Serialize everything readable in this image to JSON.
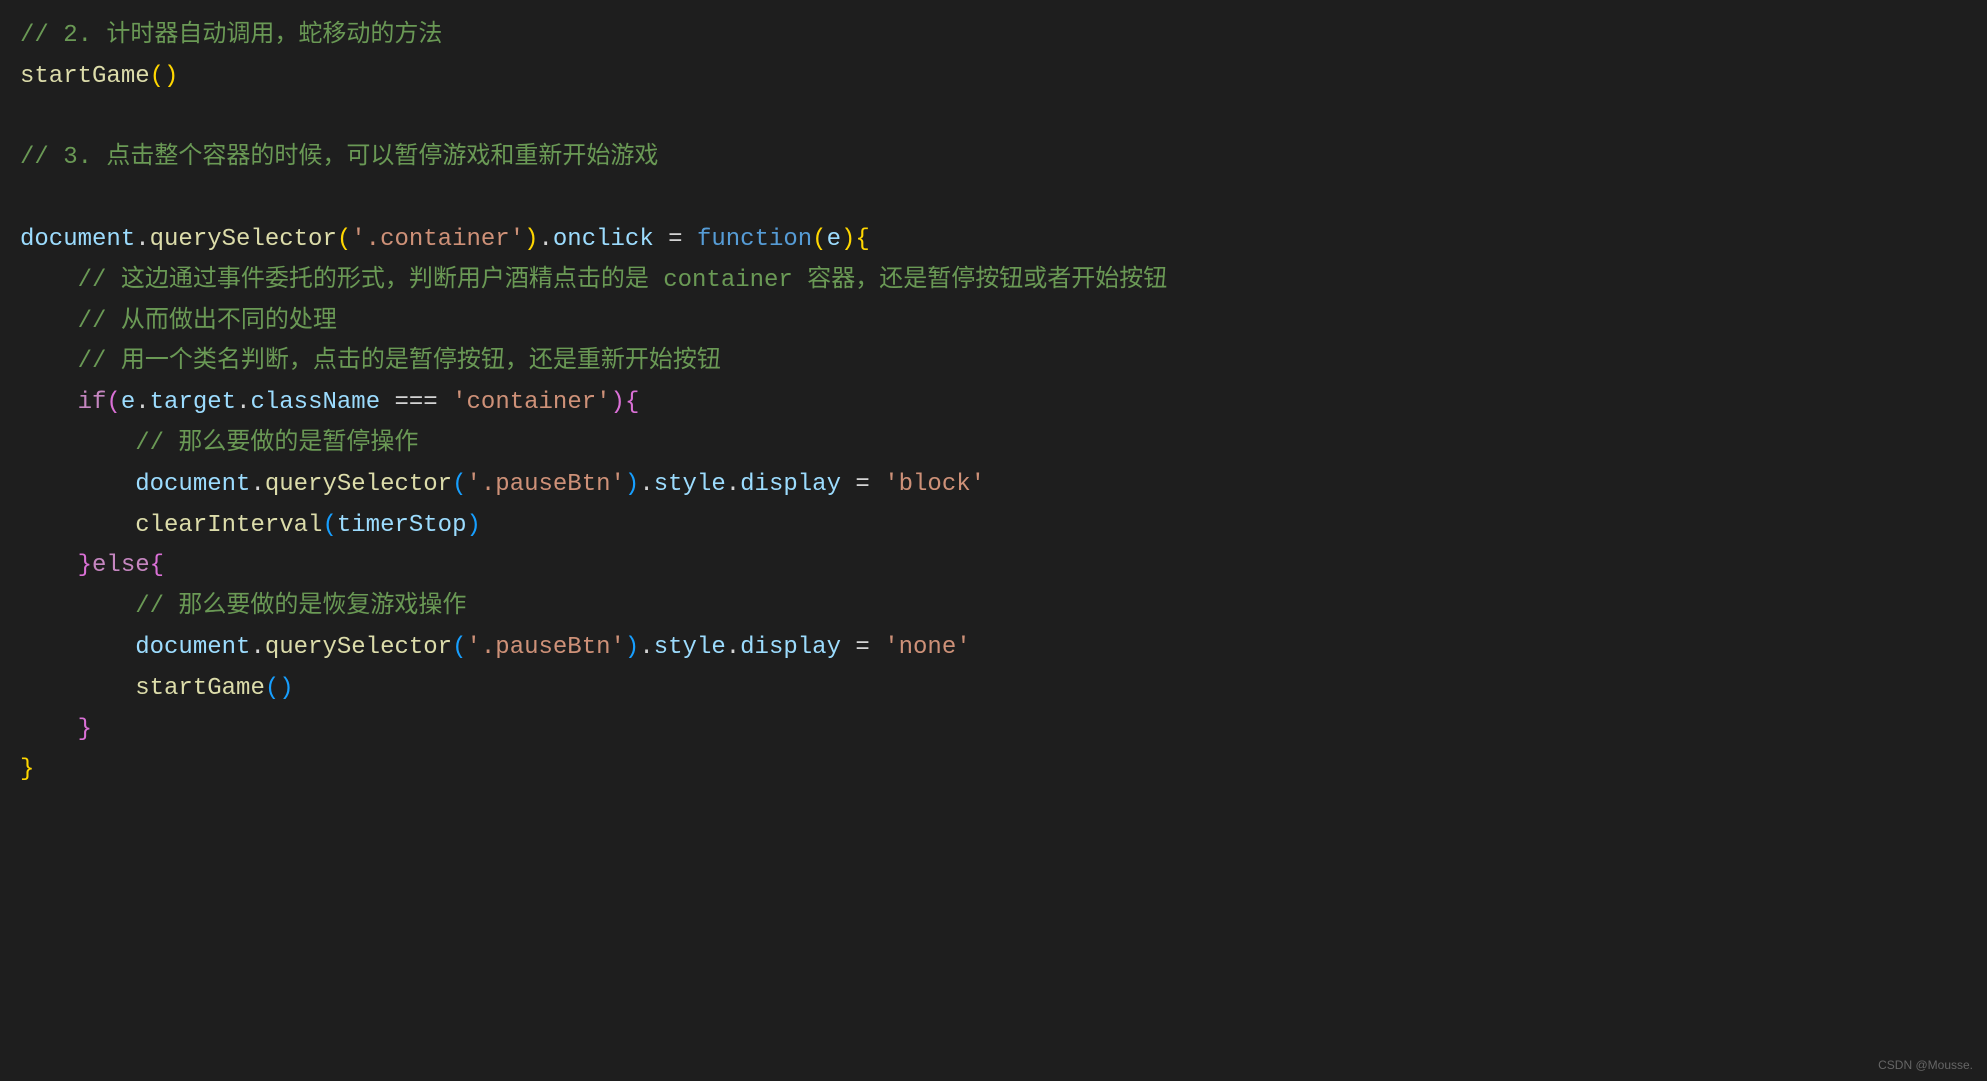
{
  "code": {
    "lines": [
      {
        "indent": 0,
        "tokens": [
          {
            "t": "// 2. 计时器自动调用，蛇移动的方法",
            "c": "comment"
          }
        ]
      },
      {
        "indent": 0,
        "tokens": [
          {
            "t": "startGame",
            "c": "fn-call"
          },
          {
            "t": "(",
            "c": "paren-yellow"
          },
          {
            "t": ")",
            "c": "paren-yellow"
          }
        ]
      },
      {
        "indent": 0,
        "tokens": []
      },
      {
        "indent": 0,
        "tokens": [
          {
            "t": "// 3. 点击整个容器的时候，可以暂停游戏和重新开始游戏",
            "c": "comment"
          }
        ]
      },
      {
        "indent": 0,
        "tokens": []
      },
      {
        "indent": 0,
        "tokens": [
          {
            "t": "document",
            "c": "variable"
          },
          {
            "t": ".",
            "c": "dot"
          },
          {
            "t": "querySelector",
            "c": "fn-call"
          },
          {
            "t": "(",
            "c": "paren-yellow"
          },
          {
            "t": "'.container'",
            "c": "string"
          },
          {
            "t": ")",
            "c": "paren-yellow"
          },
          {
            "t": ".",
            "c": "dot"
          },
          {
            "t": "onclick",
            "c": "property"
          },
          {
            "t": " = ",
            "c": "operator"
          },
          {
            "t": "function",
            "c": "keyword-blue"
          },
          {
            "t": "(",
            "c": "paren-yellow"
          },
          {
            "t": "e",
            "c": "property"
          },
          {
            "t": ")",
            "c": "paren-yellow"
          },
          {
            "t": "{",
            "c": "brace-yellow"
          }
        ]
      },
      {
        "indent": 1,
        "tokens": [
          {
            "t": "// 这边通过事件委托的形式，判断用户酒精点击的是 container 容器，还是暂停按钮或者开始按钮",
            "c": "comment"
          }
        ]
      },
      {
        "indent": 1,
        "tokens": [
          {
            "t": "// 从而做出不同的处理",
            "c": "comment"
          }
        ]
      },
      {
        "indent": 1,
        "tokens": [
          {
            "t": "// 用一个类名判断，点击的是暂停按钮，还是重新开始按钮",
            "c": "comment"
          }
        ]
      },
      {
        "indent": 1,
        "tokens": [
          {
            "t": "if",
            "c": "keyword-pink"
          },
          {
            "t": "(",
            "c": "paren-purple"
          },
          {
            "t": "e",
            "c": "property"
          },
          {
            "t": ".",
            "c": "dot"
          },
          {
            "t": "target",
            "c": "property"
          },
          {
            "t": ".",
            "c": "dot"
          },
          {
            "t": "className",
            "c": "property"
          },
          {
            "t": " === ",
            "c": "operator"
          },
          {
            "t": "'container'",
            "c": "string"
          },
          {
            "t": ")",
            "c": "paren-purple"
          },
          {
            "t": "{",
            "c": "brace-purple"
          }
        ]
      },
      {
        "indent": 2,
        "tokens": [
          {
            "t": "// 那么要做的是暂停操作",
            "c": "comment"
          }
        ]
      },
      {
        "indent": 2,
        "tokens": [
          {
            "t": "document",
            "c": "variable"
          },
          {
            "t": ".",
            "c": "dot"
          },
          {
            "t": "querySelector",
            "c": "fn-call"
          },
          {
            "t": "(",
            "c": "paren-blue"
          },
          {
            "t": "'.pauseBtn'",
            "c": "string"
          },
          {
            "t": ")",
            "c": "paren-blue"
          },
          {
            "t": ".",
            "c": "dot"
          },
          {
            "t": "style",
            "c": "property"
          },
          {
            "t": ".",
            "c": "dot"
          },
          {
            "t": "display",
            "c": "property"
          },
          {
            "t": " = ",
            "c": "operator"
          },
          {
            "t": "'block'",
            "c": "string"
          }
        ]
      },
      {
        "indent": 2,
        "tokens": [
          {
            "t": "clearInterval",
            "c": "fn-call"
          },
          {
            "t": "(",
            "c": "paren-blue"
          },
          {
            "t": "timerStop",
            "c": "property"
          },
          {
            "t": ")",
            "c": "paren-blue"
          }
        ]
      },
      {
        "indent": 1,
        "tokens": [
          {
            "t": "}",
            "c": "brace-purple"
          },
          {
            "t": "else",
            "c": "keyword-pink"
          },
          {
            "t": "{",
            "c": "brace-purple"
          }
        ]
      },
      {
        "indent": 2,
        "tokens": [
          {
            "t": "// 那么要做的是恢复游戏操作",
            "c": "comment"
          }
        ]
      },
      {
        "indent": 2,
        "tokens": [
          {
            "t": "document",
            "c": "variable"
          },
          {
            "t": ".",
            "c": "dot"
          },
          {
            "t": "querySelector",
            "c": "fn-call"
          },
          {
            "t": "(",
            "c": "paren-blue"
          },
          {
            "t": "'.pauseBtn'",
            "c": "string"
          },
          {
            "t": ")",
            "c": "paren-blue"
          },
          {
            "t": ".",
            "c": "dot"
          },
          {
            "t": "style",
            "c": "property"
          },
          {
            "t": ".",
            "c": "dot"
          },
          {
            "t": "display",
            "c": "property"
          },
          {
            "t": " = ",
            "c": "operator"
          },
          {
            "t": "'none'",
            "c": "string"
          }
        ]
      },
      {
        "indent": 2,
        "tokens": [
          {
            "t": "startGame",
            "c": "fn-call"
          },
          {
            "t": "(",
            "c": "paren-blue"
          },
          {
            "t": ")",
            "c": "paren-blue"
          }
        ]
      },
      {
        "indent": 1,
        "tokens": [
          {
            "t": "}",
            "c": "brace-purple"
          }
        ]
      },
      {
        "indent": 0,
        "tokens": [
          {
            "t": "}",
            "c": "brace-yellow"
          }
        ]
      }
    ]
  },
  "watermark": "CSDN @Mousse."
}
